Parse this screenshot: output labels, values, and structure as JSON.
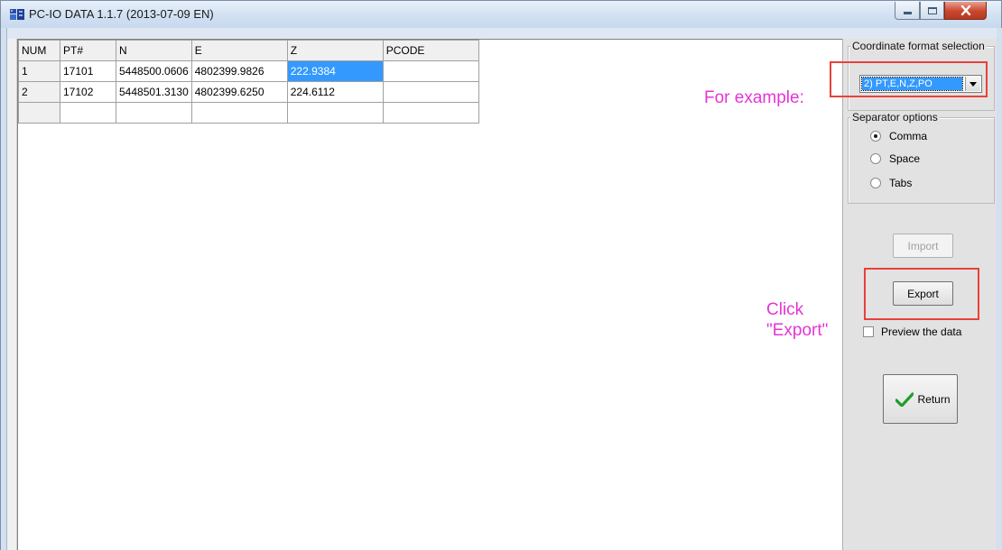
{
  "window": {
    "title": "PC-IO DATA 1.1.7 (2013-07-09 EN)"
  },
  "grid": {
    "columns": [
      "NUM",
      "PT#",
      "N",
      "E",
      "Z",
      "PCODE"
    ],
    "rows": [
      [
        "1",
        "17101",
        "5448500.0606",
        "4802399.9826",
        "222.9384",
        ""
      ],
      [
        "2",
        "17102",
        "5448501.3130",
        "4802399.6250",
        "224.6112",
        ""
      ],
      [
        "",
        "",
        "",
        "",
        "",
        ""
      ]
    ]
  },
  "panel": {
    "format_group_label": "Coordinate format selection",
    "format_selected": "2) PT,E,N,Z,PO",
    "separator_group_label": "Separator options",
    "separators": [
      {
        "label": "Comma",
        "checked": true
      },
      {
        "label": "Space",
        "checked": false
      },
      {
        "label": "Tabs",
        "checked": false
      }
    ],
    "import_label": "Import",
    "export_label": "Export",
    "preview_label": "Preview the data",
    "return_label": "Return"
  },
  "annotations": {
    "example_text": "For example:",
    "click_line1": "Click",
    "click_line2": "\"Export\"",
    "color": "#e535d5",
    "box_color": "#e8413d"
  },
  "icons": {
    "app": "app-icon",
    "minimize": "minimize-icon",
    "maximize": "maximize-icon",
    "close": "close-icon",
    "dropdown": "chevron-down-icon",
    "return": "checkmark-icon"
  }
}
